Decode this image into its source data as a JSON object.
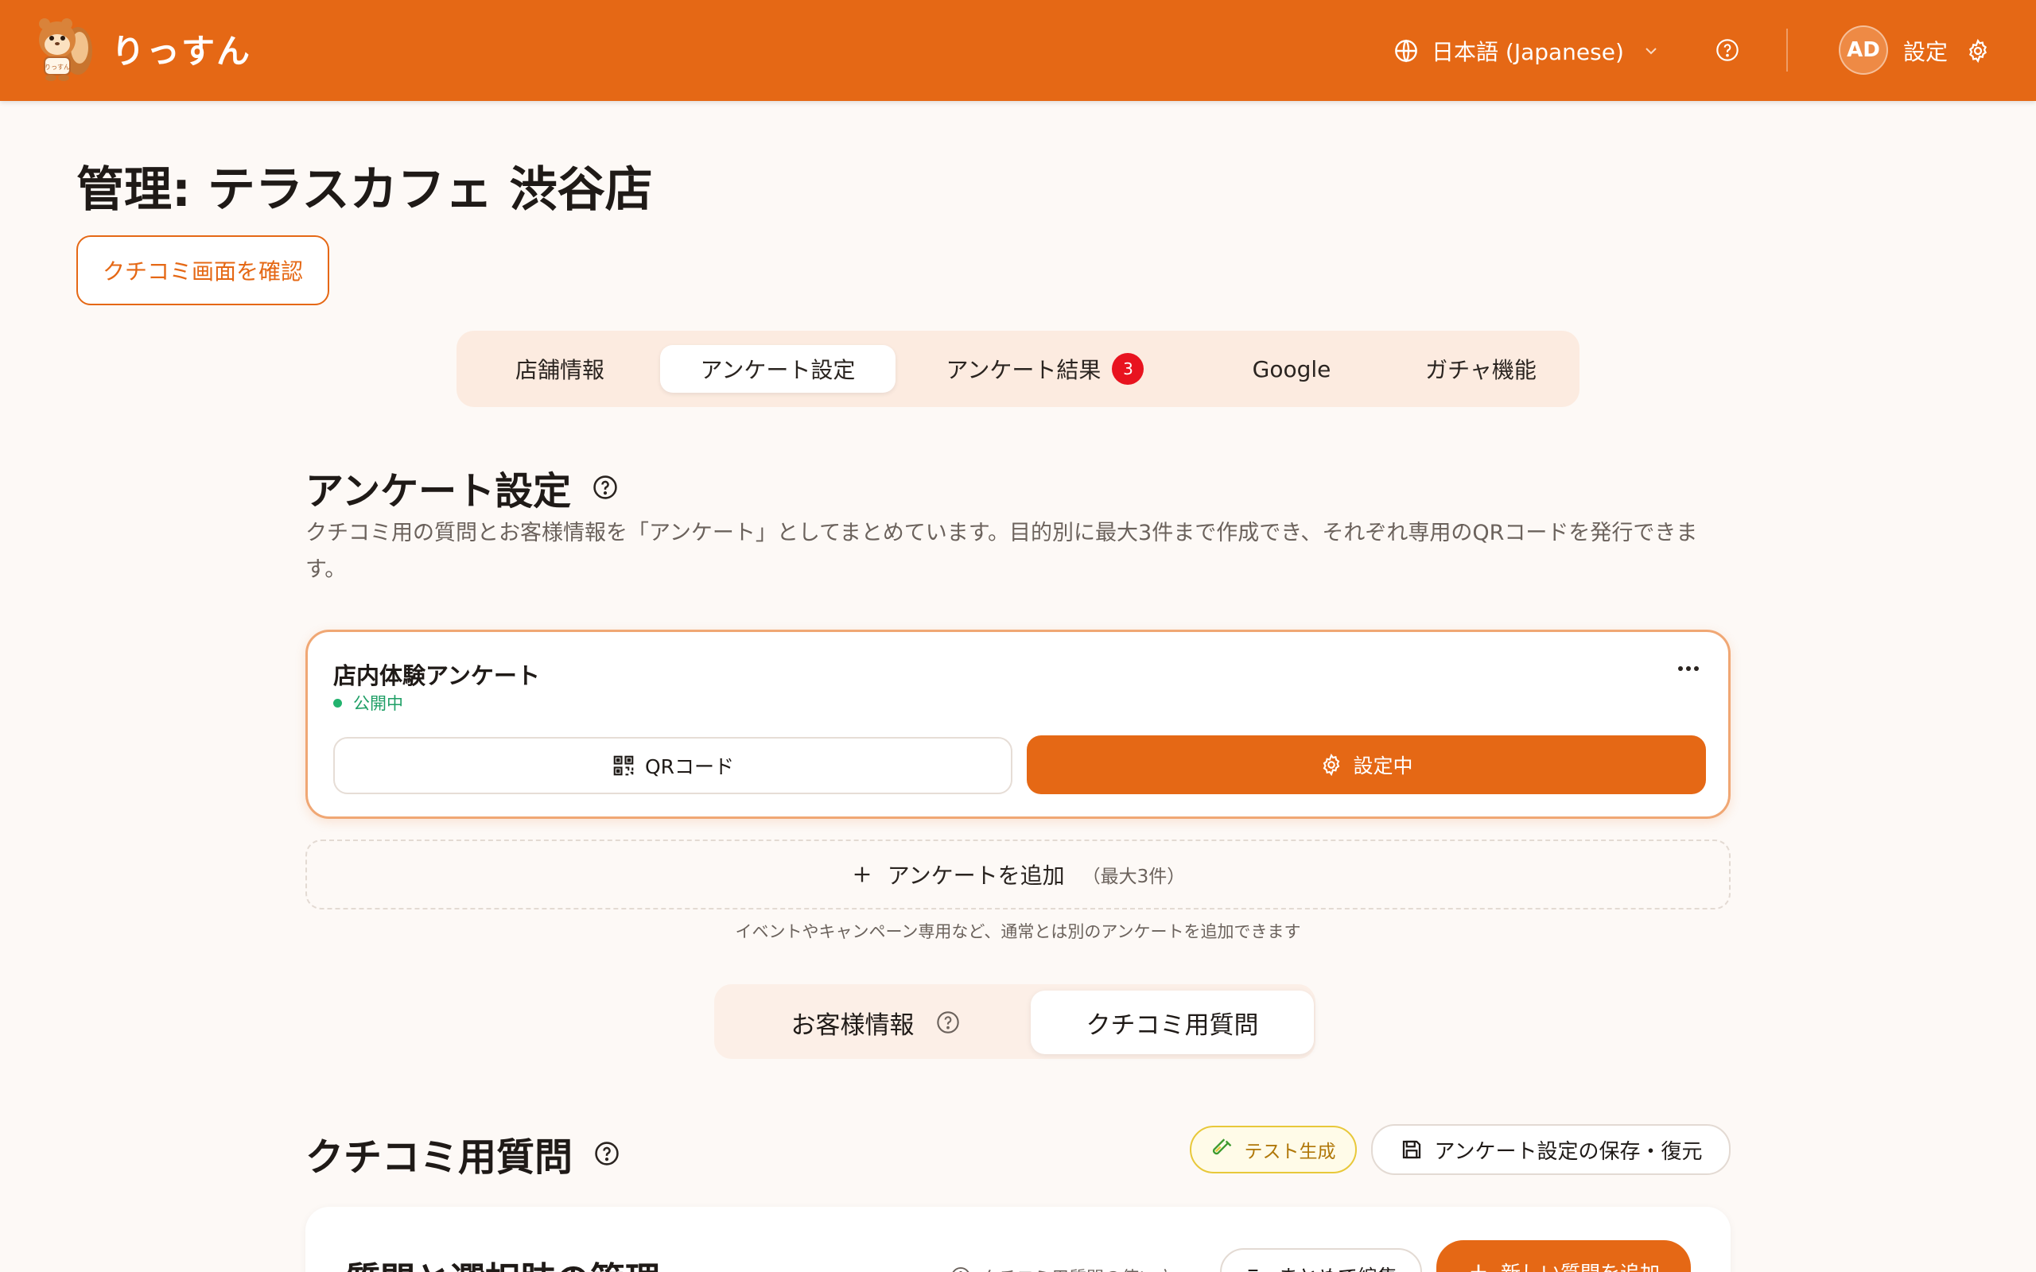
{
  "header": {
    "logo_text": "りっすん",
    "language": "日本語 (Japanese)",
    "avatar": "AD",
    "settings_label": "設定"
  },
  "page": {
    "title": "管理: テラスカフェ 渋谷店",
    "review_button": "クチコミ画面を確認"
  },
  "tabs": [
    {
      "label": "店舗情報"
    },
    {
      "label": "アンケート設定",
      "active": true
    },
    {
      "label": "アンケート結果",
      "badge": "3"
    },
    {
      "label": "Google"
    },
    {
      "label": "ガチャ機能"
    }
  ],
  "survey_section": {
    "title": "アンケート設定",
    "description": "クチコミ用の質問とお客様情報を「アンケート」としてまとめています。目的別に最大3件まで作成でき、それぞれ専用のQRコードを発行できます。"
  },
  "survey_card": {
    "name": "店内体験アンケート",
    "status": "公開中",
    "qr_label": "QRコード",
    "configuring_label": "設定中"
  },
  "add_survey": {
    "label": "アンケートを追加",
    "limit": "（最大3件）",
    "hint": "イベントやキャンペーン専用など、通常とは別のアンケートを追加できます"
  },
  "subtabs": [
    {
      "label": "お客様情報"
    },
    {
      "label": "クチコミ用質問",
      "active": true
    }
  ],
  "questions_section": {
    "title": "クチコミ用質問",
    "test_button": "テスト生成",
    "save_button": "アンケート設定の保存・復元"
  },
  "management_card": {
    "title": "質問と選択肢の管理",
    "help_link": "クチコミ用質問の使い方",
    "bulk_edit": "まとめて編集",
    "add_question": "新しい質問を追加"
  },
  "colors": {
    "brand": "#e56815",
    "badge": "#e8131f",
    "status_green": "#22b36e"
  }
}
